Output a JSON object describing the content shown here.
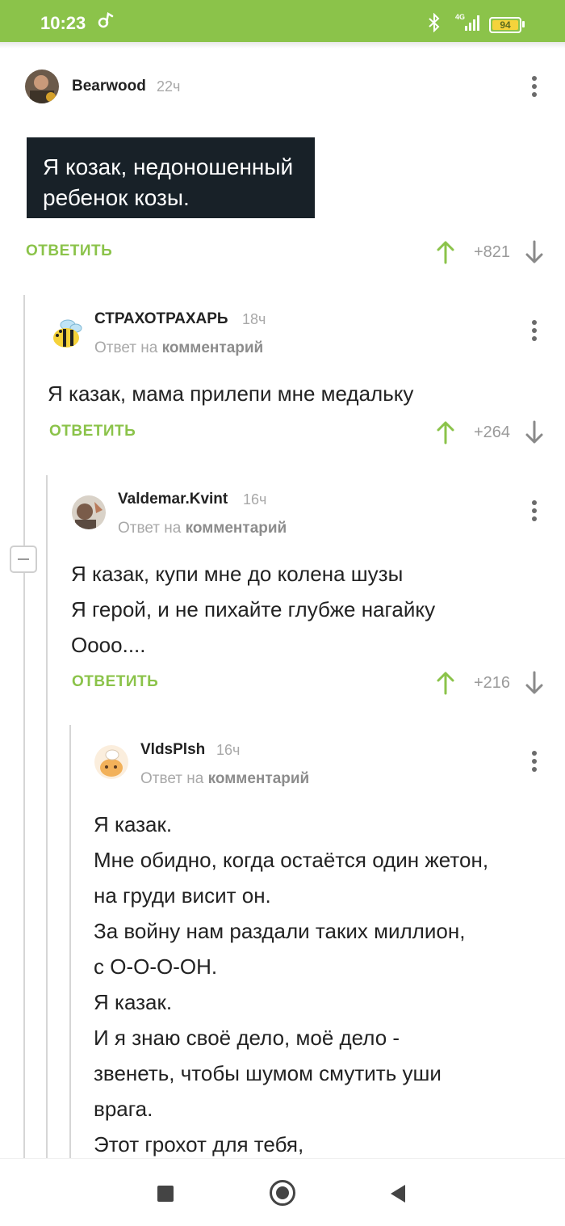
{
  "status_bar": {
    "time": "10:23",
    "battery": "94",
    "network": "4G"
  },
  "comments": [
    {
      "username": "Bearwood",
      "time": "22ч",
      "quote_lines": [
        "Я козак, недоношенный",
        "ребенок козы."
      ],
      "reply_label": "ОТВЕТИТЬ",
      "score": "+821"
    },
    {
      "username": "СТРАХОТРАХАРЬ",
      "time": "18ч",
      "reply_prefix": "Ответ на",
      "reply_target": "комментарий",
      "lines": [
        "Я казак, мама прилепи мне медальку"
      ],
      "reply_label": "ОТВЕТИТЬ",
      "score": "+264"
    },
    {
      "username": "Valdemar.Kvint",
      "time": "16ч",
      "reply_prefix": "Ответ на",
      "reply_target": "комментарий",
      "lines": [
        "Я казак, купи мне до колена шузы",
        "Я герой, и не пихайте глубже нагайку",
        "Оооо...."
      ],
      "reply_label": "ОТВЕТИТЬ",
      "score": "+216"
    },
    {
      "username": "VldsPlsh",
      "time": "16ч",
      "reply_prefix": "Ответ на",
      "reply_target": "комментарий",
      "lines": [
        "Я казак.",
        "Мне обидно, когда остаётся один жетон,",
        "на груди висит он.",
        "За войну нам раздали таких миллион,",
        "с О-О-О-ОН.",
        "Я казак.",
        "И я знаю своё дело, моё дело -",
        "звенеть, чтобы шумом смутить уши",
        "врага.",
        "Этот грохот для тебя,"
      ]
    }
  ],
  "colors": {
    "accent": "#8bc34a",
    "status_bar": "#8bc34a",
    "quote_bg": "#182128"
  },
  "icons": [
    "music-note-icon",
    "bluetooth-icon",
    "signal-icon",
    "battery-icon",
    "more-vert-icon",
    "arrow-up-icon",
    "arrow-down-icon",
    "collapse-icon",
    "recents-icon",
    "home-icon",
    "back-icon"
  ]
}
